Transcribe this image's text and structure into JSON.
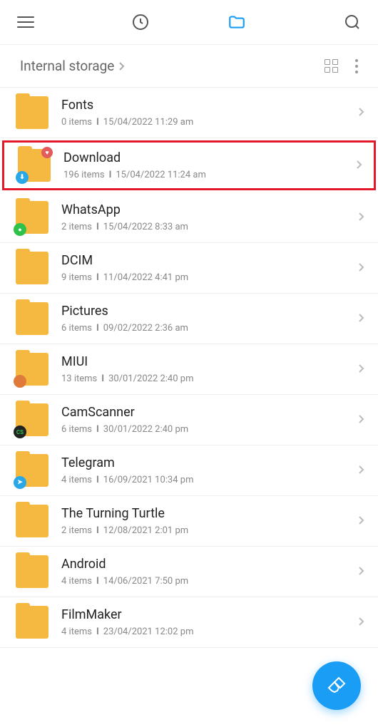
{
  "breadcrumb": "Internal storage",
  "folders": [
    {
      "name": "Fonts",
      "items": "0 items",
      "date": "15/04/2022 11:29 am",
      "highlighted": false,
      "badges": []
    },
    {
      "name": "Download",
      "items": "196 items",
      "date": "15/04/2022 11:24 am",
      "highlighted": true,
      "badges": [
        {
          "pos": "tr",
          "color": "#e35b5b",
          "glyph": "♥",
          "glyphColor": "#fff"
        },
        {
          "pos": "bl",
          "color": "#2aa7e6",
          "glyph": "⬇",
          "glyphColor": "#fff"
        }
      ]
    },
    {
      "name": "WhatsApp",
      "items": "2 items",
      "date": "15/04/2022 8:33 am",
      "highlighted": false,
      "badges": [
        {
          "pos": "bl",
          "color": "#2ec24a",
          "glyph": "●",
          "glyphColor": "#fff"
        }
      ]
    },
    {
      "name": "DCIM",
      "items": "9 items",
      "date": "11/04/2022 4:41 pm",
      "highlighted": false,
      "badges": []
    },
    {
      "name": "Pictures",
      "items": "6 items",
      "date": "09/02/2022 2:36 am",
      "highlighted": false,
      "badges": []
    },
    {
      "name": "MIUI",
      "items": "13 items",
      "date": "30/01/2022 2:40 pm",
      "highlighted": false,
      "badges": [
        {
          "pos": "bl",
          "color": "#e07a3a",
          "glyph": "",
          "glyphColor": "#fff"
        }
      ]
    },
    {
      "name": "CamScanner",
      "items": "6 items",
      "date": "30/01/2022 2:40 pm",
      "highlighted": false,
      "badges": [
        {
          "pos": "bl",
          "color": "#222",
          "glyph": "CS",
          "glyphColor": "#2ec24a"
        }
      ]
    },
    {
      "name": "Telegram",
      "items": "4 items",
      "date": "16/09/2021 10:34 pm",
      "highlighted": false,
      "badges": [
        {
          "pos": "bl",
          "color": "#2aa7e6",
          "glyph": "➤",
          "glyphColor": "#fff"
        }
      ]
    },
    {
      "name": "The Turning Turtle",
      "items": "2 items",
      "date": "12/08/2021 2:01 pm",
      "highlighted": false,
      "badges": []
    },
    {
      "name": "Android",
      "items": "4 items",
      "date": "14/06/2021 7:50 pm",
      "highlighted": false,
      "badges": []
    },
    {
      "name": "FilmMaker",
      "items": "4 items",
      "date": "23/04/2021 12:02 pm",
      "highlighted": false,
      "badges": []
    }
  ]
}
